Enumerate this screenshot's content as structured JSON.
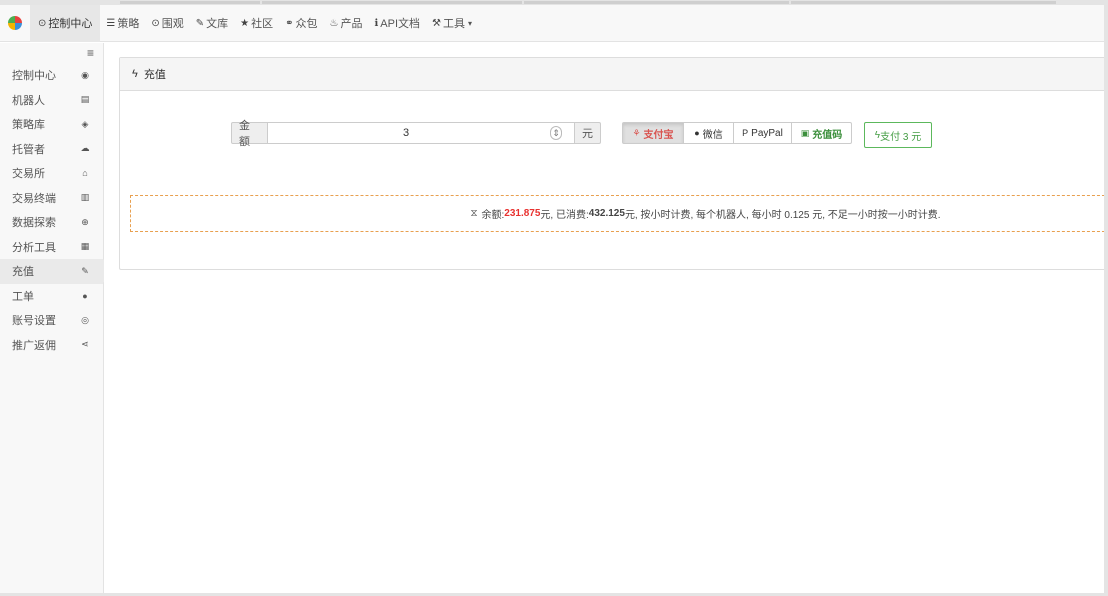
{
  "topnav": {
    "items": [
      {
        "icon": "⊙",
        "label": "控制中心",
        "active": true
      },
      {
        "icon": "☰",
        "label": "策略"
      },
      {
        "icon": "⊙",
        "label": "围观"
      },
      {
        "icon": "✎",
        "label": "文库"
      },
      {
        "icon": "★",
        "label": "社区"
      },
      {
        "icon": "⚭",
        "label": "众包"
      },
      {
        "icon": "♨",
        "label": "产品"
      },
      {
        "icon": "ℹ",
        "label": "API文档"
      },
      {
        "icon": "⚒",
        "label": "工具"
      }
    ]
  },
  "sidebar": {
    "items": [
      {
        "label": "控制中心",
        "icon": "dashboard-icon"
      },
      {
        "label": "机器人",
        "icon": "robot-icon"
      },
      {
        "label": "策略库",
        "icon": "cube-icon"
      },
      {
        "label": "托管者",
        "icon": "cloud-icon"
      },
      {
        "label": "交易所",
        "icon": "bank-icon"
      },
      {
        "label": "交易终端",
        "icon": "bar-chart-icon"
      },
      {
        "label": "数据探索",
        "icon": "magnify-icon"
      },
      {
        "label": "分析工具",
        "icon": "calculator-icon"
      },
      {
        "label": "充值",
        "icon": "wrench-icon",
        "active": true
      },
      {
        "label": "工单",
        "icon": "comment-icon"
      },
      {
        "label": "账号设置",
        "icon": "user-circle-icon"
      },
      {
        "label": "推广返佣",
        "icon": "share-icon"
      }
    ]
  },
  "panel": {
    "title": "充值",
    "amount_label": "金额",
    "amount_value": "3",
    "unit": "元",
    "pay_methods": [
      {
        "label": "支付宝",
        "icon": "alipay-icon",
        "active": true
      },
      {
        "label": "微信",
        "icon": "wechat-icon"
      },
      {
        "label": "PayPal",
        "icon": "paypal-icon"
      },
      {
        "label": "充值码",
        "icon": "voucher-icon"
      }
    ],
    "submit_label": "支付 3 元"
  },
  "notice": {
    "balance_label": "余额: ",
    "balance": "231.875",
    "spent_label": " 元, 已消费: ",
    "spent": "432.125",
    "rest": " 元, 按小时计费, 每个机器人, 每小时 0.125 元, 不足一小时按一小时计费."
  },
  "colors": {
    "accent_red": "#e8312f",
    "success_green": "#449d44",
    "notice_border": "#e8a050"
  }
}
